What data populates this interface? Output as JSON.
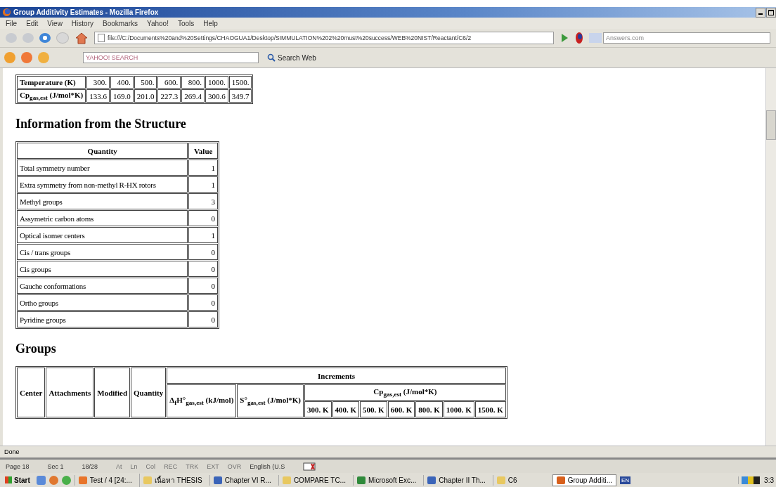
{
  "window": {
    "title": "Group Additivity Estimates - Mozilla Firefox"
  },
  "menu": [
    "File",
    "Edit",
    "View",
    "History",
    "Bookmarks",
    "Yahoo!",
    "Tools",
    "Help"
  ],
  "navigation": {
    "url": "file:///C:/Documents%20and%20Settings/CHAOGUA1/Desktop/SIMMULATION%202%20must%20success/WEB%20NIST/Reactant/C6/2",
    "search_placeholder": "Answers.com"
  },
  "yahoo_toolbar": {
    "search_placeholder": "YAHOO! SEARCH",
    "search_button": "Search Web"
  },
  "heat_capacity_table": {
    "rows": [
      {
        "header": "Temperature (K)",
        "cells": [
          "300.",
          "400.",
          "500.",
          "600.",
          "800.",
          "1000.",
          "1500."
        ]
      },
      {
        "header": "Cp$_{gas,est}$ (J/mol*K)",
        "cells": [
          "133.6",
          "169.0",
          "201.0",
          "227.3",
          "269.4",
          "300.6",
          "349.7"
        ]
      }
    ]
  },
  "structure_section": {
    "heading": "Information from the Structure",
    "columns": [
      "Quantity",
      "Value"
    ],
    "rows": [
      {
        "quantity": "Total symmetry number",
        "value": "1"
      },
      {
        "quantity": "Extra symmetry from non-methyl R-HX rotors",
        "value": "1"
      },
      {
        "quantity": "Methyl groups",
        "value": "3"
      },
      {
        "quantity": "Assymetric carbon atoms",
        "value": "0"
      },
      {
        "quantity": "Optical isomer centers",
        "value": "1"
      },
      {
        "quantity": "Cis / trans groups",
        "value": "0"
      },
      {
        "quantity": "Cis groups",
        "value": "0"
      },
      {
        "quantity": "Gauche conformations",
        "value": "0"
      },
      {
        "quantity": "Ortho groups",
        "value": "0"
      },
      {
        "quantity": "Pyridine groups",
        "value": "0"
      }
    ]
  },
  "groups_section": {
    "heading": "Groups",
    "columns": [
      "Center",
      "Attachments",
      "Modified",
      "Quantity"
    ],
    "increments": "Increments",
    "enthalpy": "Δ$_{f}$H°$_{gas,est}$ (kJ/mol)",
    "entropy": "S°$_{gas,est}$ (J/mol*K)",
    "cp": "Cp$_{gas,est}$ (J/mol*K)",
    "cp_temperatures": [
      "300. K",
      "400. K",
      "500. K",
      "600. K",
      "800. K",
      "1000. K",
      "1500. K"
    ]
  },
  "status_bar": "Done",
  "word_status": [
    {
      "text": "Page 18",
      "disabled": false
    },
    {
      "text": "Sec 1",
      "disabled": false
    },
    {
      "text": "18/28",
      "disabled": false
    },
    {
      "text": "At",
      "disabled": true
    },
    {
      "text": "Ln",
      "disabled": true
    },
    {
      "text": "Col",
      "disabled": true
    },
    {
      "text": "REC",
      "disabled": true
    },
    {
      "text": "TRK",
      "disabled": true
    },
    {
      "text": "EXT",
      "disabled": true
    },
    {
      "text": "OVR",
      "disabled": true
    },
    {
      "text": "English (U.S",
      "disabled": false
    }
  ],
  "taskbar": {
    "start": "Start",
    "tasks": [
      {
        "label": "Test / 4 [24:...",
        "kind": "app",
        "selected": false
      },
      {
        "label": "เนื้อหา THESIS",
        "kind": "folder",
        "selected": false
      },
      {
        "label": "Chapter VI R...",
        "kind": "word",
        "selected": false
      },
      {
        "label": "COMPARE TC...",
        "kind": "folder",
        "selected": false
      },
      {
        "label": "Microsoft Exc...",
        "kind": "excel",
        "selected": false
      },
      {
        "label": "Chapter II Th...",
        "kind": "word",
        "selected": false
      },
      {
        "label": "C6",
        "kind": "folder",
        "selected": false
      },
      {
        "label": "Group Additi...",
        "kind": "firefox",
        "selected": true
      }
    ],
    "language": "EN",
    "clock": "3:3"
  }
}
